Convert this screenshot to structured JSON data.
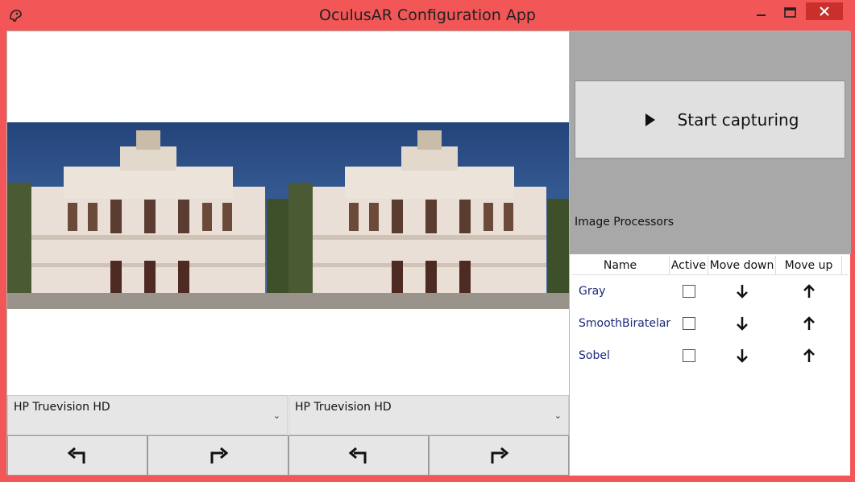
{
  "window": {
    "title": "OculusAR Configuration App"
  },
  "cameras": {
    "left": {
      "selected": "HP Truevision HD"
    },
    "right": {
      "selected": "HP Truevision HD"
    }
  },
  "side": {
    "start_label": "Start capturing",
    "processors_title": "Image Processors",
    "columns": [
      "Name",
      "Active",
      "Move down",
      "Move up"
    ],
    "processors": [
      {
        "name": "Gray",
        "active": false
      },
      {
        "name": "SmoothBiratelar",
        "active": false
      },
      {
        "name": "Sobel",
        "active": false
      }
    ]
  },
  "icons": {
    "title": "app-icon",
    "rotate_left": "rotate-left-icon",
    "rotate_right": "rotate-right-icon",
    "play": "play-icon",
    "down": "arrow-down-icon",
    "up": "arrow-up-icon"
  },
  "colors": {
    "titlebar": "#f25656",
    "close_button": "#c9302c",
    "panel_gray": "#a8a8a8",
    "link_text": "#1a2a7a"
  }
}
